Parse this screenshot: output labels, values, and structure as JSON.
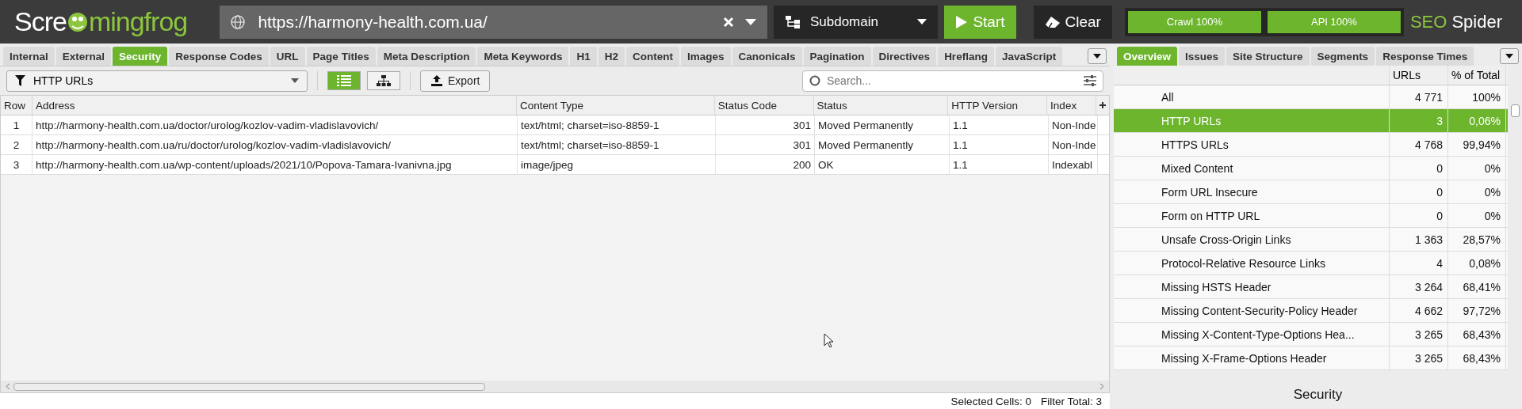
{
  "logo": {
    "text_start": "Scre",
    "text_end": "mingfrog"
  },
  "url_field": {
    "value": "https://harmony-health.com.ua/"
  },
  "mode_dropdown": {
    "value": "Subdomain"
  },
  "buttons": [
    {
      "label": "Start",
      "kind": "start"
    },
    {
      "label": "Clear",
      "kind": "clear"
    }
  ],
  "progress": [
    {
      "label": "Crawl 100%",
      "level": 1
    },
    {
      "label": "API 100%",
      "level": 1
    }
  ],
  "product": {
    "brand": "SEO",
    "name": "Spider"
  },
  "tabs": [
    {
      "label": "Internal",
      "selected": false
    },
    {
      "label": "External",
      "selected": false
    },
    {
      "label": "Security",
      "selected": true
    },
    {
      "label": "Response Codes",
      "selected": false
    },
    {
      "label": "URL",
      "selected": false
    },
    {
      "label": "Page Titles",
      "selected": false
    },
    {
      "label": "Meta Description",
      "selected": false
    },
    {
      "label": "Meta Keywords",
      "selected": false
    },
    {
      "label": "H1",
      "selected": false
    },
    {
      "label": "H2",
      "selected": false
    },
    {
      "label": "Content",
      "selected": false
    },
    {
      "label": "Images",
      "selected": false
    },
    {
      "label": "Canonicals",
      "selected": false
    },
    {
      "label": "Pagination",
      "selected": false
    },
    {
      "label": "Directives",
      "selected": false
    },
    {
      "label": "Hreflang",
      "selected": false
    },
    {
      "label": "JavaScript",
      "selected": false
    }
  ],
  "filter": {
    "value": "HTTP URLs"
  },
  "view_toggle": [
    {
      "kind": "list",
      "selected": true
    },
    {
      "kind": "tree",
      "selected": false
    }
  ],
  "export_button": "Export",
  "search": {
    "placeholder": "Search..."
  },
  "table": {
    "columns": [
      {
        "label": "Row"
      },
      {
        "label": "Address"
      },
      {
        "label": "Content Type"
      },
      {
        "label": "Status Code"
      },
      {
        "label": "Status"
      },
      {
        "label": "HTTP Version"
      },
      {
        "label": "Index"
      }
    ],
    "rows": [
      {
        "cells": [
          "1",
          "http://harmony-health.com.ua/doctor/urolog/kozlov-vadim-vladislavovich/",
          "text/html; charset=iso-8859-1",
          "301",
          "Moved Permanently",
          "1.1",
          "Non-Inde"
        ]
      },
      {
        "cells": [
          "2",
          "http://harmony-health.com.ua/ru/doctor/urolog/kozlov-vadim-vladislavovich/",
          "text/html; charset=iso-8859-1",
          "301",
          "Moved Permanently",
          "1.1",
          "Non-Inde"
        ]
      },
      {
        "cells": [
          "3",
          "http://harmony-health.com.ua/wp-content/uploads/2021/10/Popova-Tamara-Ivanivna.jpg",
          "image/jpeg",
          "200",
          "OK",
          "1.1",
          "Indexabl"
        ]
      }
    ]
  },
  "status_bar": {
    "selected_cells_label": "Selected Cells:",
    "selected_cells": "0",
    "filter_total_label": "Filter Total:",
    "filter_total": "3"
  },
  "right_tabs": [
    {
      "label": "Overview",
      "selected": true
    },
    {
      "label": "Issues",
      "selected": false
    },
    {
      "label": "Site Structure",
      "selected": false
    },
    {
      "label": "Segments",
      "selected": false
    },
    {
      "label": "Response Times",
      "selected": false
    }
  ],
  "overview": {
    "columns": [
      "URLs",
      "% of Total"
    ],
    "rows": [
      {
        "name": "All",
        "urls": "4 771",
        "percent": "100%",
        "selected": false
      },
      {
        "name": "HTTP URLs",
        "urls": "3",
        "percent": "0,06%",
        "selected": true
      },
      {
        "name": "HTTPS URLs",
        "urls": "4 768",
        "percent": "99,94%",
        "selected": false
      },
      {
        "name": "Mixed Content",
        "urls": "0",
        "percent": "0%",
        "selected": false
      },
      {
        "name": "Form URL Insecure",
        "urls": "0",
        "percent": "0%",
        "selected": false
      },
      {
        "name": "Form on HTTP URL",
        "urls": "0",
        "percent": "0%",
        "selected": false
      },
      {
        "name": "Unsafe Cross-Origin Links",
        "urls": "1 363",
        "percent": "28,57%",
        "selected": false
      },
      {
        "name": "Protocol-Relative Resource Links",
        "urls": "4",
        "percent": "0,08%",
        "selected": false
      },
      {
        "name": "Missing HSTS Header",
        "urls": "3 264",
        "percent": "68,41%",
        "selected": false
      },
      {
        "name": "Missing Content-Security-Policy Header",
        "urls": "4 662",
        "percent": "97,72%",
        "selected": false
      },
      {
        "name": "Missing X-Content-Type-Options Hea...",
        "urls": "3 265",
        "percent": "68,43%",
        "selected": false
      },
      {
        "name": "Missing X-Frame-Options Header",
        "urls": "3 265",
        "percent": "68,43%",
        "selected": false
      }
    ]
  },
  "chart_title": "Security"
}
